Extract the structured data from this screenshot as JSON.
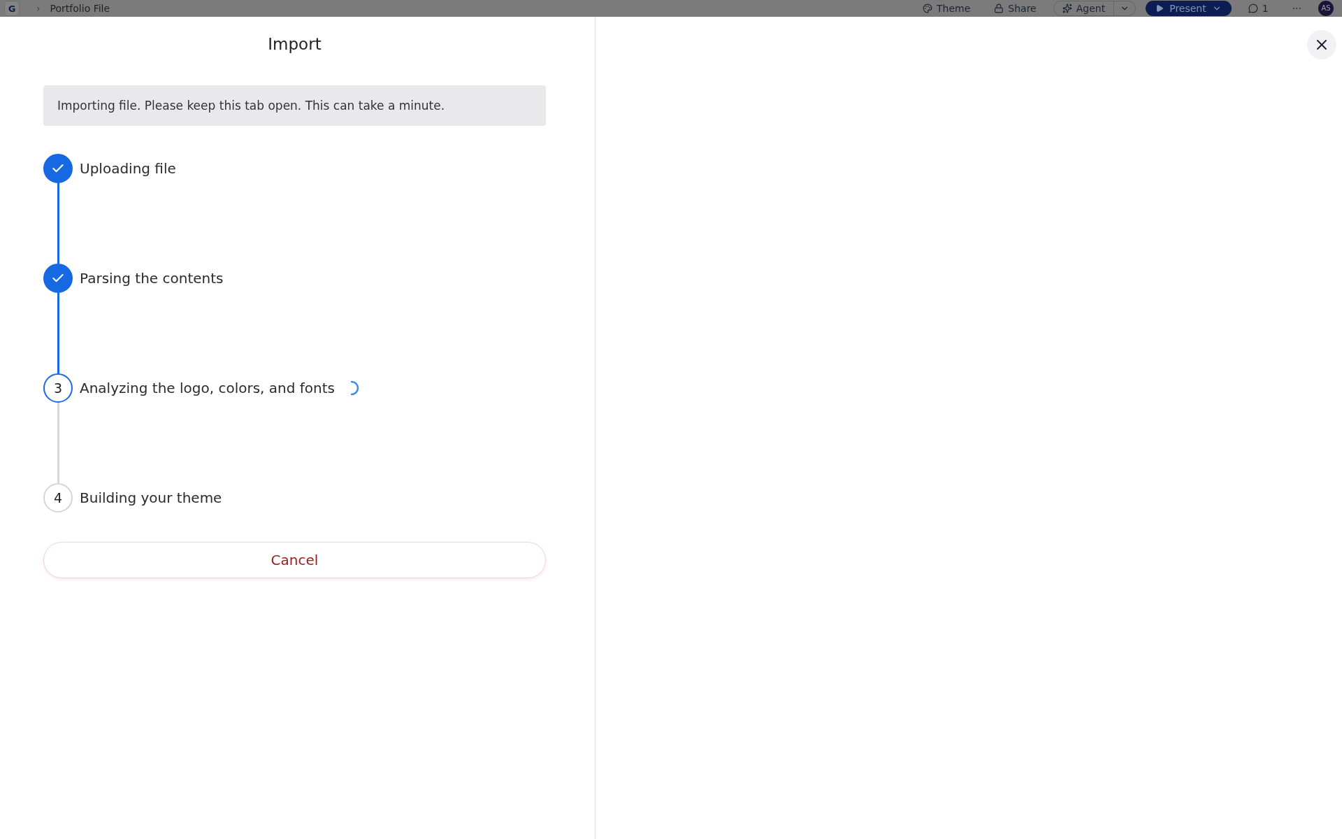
{
  "top_bar": {
    "logo": "G",
    "breadcrumb_separator": "›",
    "file_name": "Portfolio File",
    "theme_button": "Theme",
    "share_button": "Share",
    "agent_button": "Agent",
    "present_button": "Present",
    "comments_count": "1",
    "more_button": "···",
    "avatar": "AS"
  },
  "dialog": {
    "title": "Import",
    "notice": "Importing file. Please keep this tab open. This can take a minute.",
    "steps": [
      {
        "label": "Uploading file",
        "completed": true,
        "current": false
      },
      {
        "label": "Parsing the contents",
        "completed": true,
        "current": false
      },
      {
        "label": "Analyzing the logo, colors, and fonts",
        "completed": false,
        "current": true,
        "number": "3"
      },
      {
        "label": "Building your theme",
        "completed": false,
        "current": false,
        "number": "4"
      }
    ],
    "cancel_button": "Cancel"
  }
}
